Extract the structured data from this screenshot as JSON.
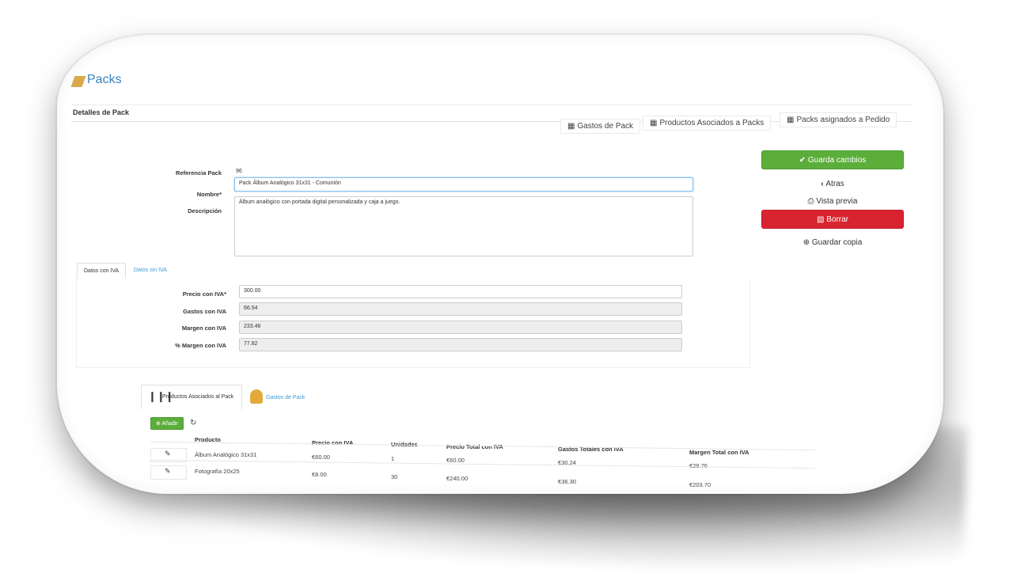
{
  "page": {
    "title": "Packs"
  },
  "panel": {
    "header": "Detalles de Pack"
  },
  "top_tabs": [
    {
      "icon": "table-icon",
      "label": "Gastos de Pack"
    },
    {
      "icon": "table-icon",
      "label": "Productos Asociados a Packs"
    },
    {
      "icon": "table-icon",
      "label": "Packs asignados a Pedido"
    }
  ],
  "form": {
    "ref_label": "Referencia Pack",
    "ref_value": "96",
    "name_label": "Nombre*",
    "name_value": "Pack Álbum Analógico 31x31 - Comunión",
    "desc_label": "Descripción",
    "desc_value": "Álbum analógico con portada digital personalizada y caja a juego."
  },
  "actions": {
    "save": "Guarda cambios",
    "back": "Atras",
    "preview": "Vista previa",
    "delete": "Borrar",
    "copy": "Guardar copia"
  },
  "iva_tabs": {
    "active": "Datos con IVA",
    "other": "Datos sin IVA"
  },
  "iva_fields": [
    {
      "label": "Precio con IVA*",
      "value": "300.00"
    },
    {
      "label": "Gastos con IVA",
      "value": "66.54"
    },
    {
      "label": "Margen con IVA",
      "value": "233.46"
    },
    {
      "label": "% Margen con IVA",
      "value": "77.82"
    }
  ],
  "bottom_tabs": {
    "products": "Productos Asociados al Pack",
    "costs": "Gastos de Pack"
  },
  "table": {
    "add_label": "Añadir",
    "headers": [
      "Producto",
      "Precio con IVA",
      "Unidades",
      "Precio Total con IVA",
      "Gastos Totales con IVA",
      "Margen Total con IVA"
    ],
    "rows": [
      [
        "Álbum Analógico 31x31",
        "€60.00",
        "1",
        "€60.00",
        "€30.24",
        "€29.76"
      ],
      [
        "Fotografía 20x25",
        "€8.00",
        "30",
        "€240.00",
        "€36.30",
        "€203.70"
      ]
    ]
  },
  "colors": {
    "accent": "#3a83c0",
    "save": "#5cae3b",
    "delete": "#d82430",
    "link": "#3a9ad9"
  }
}
